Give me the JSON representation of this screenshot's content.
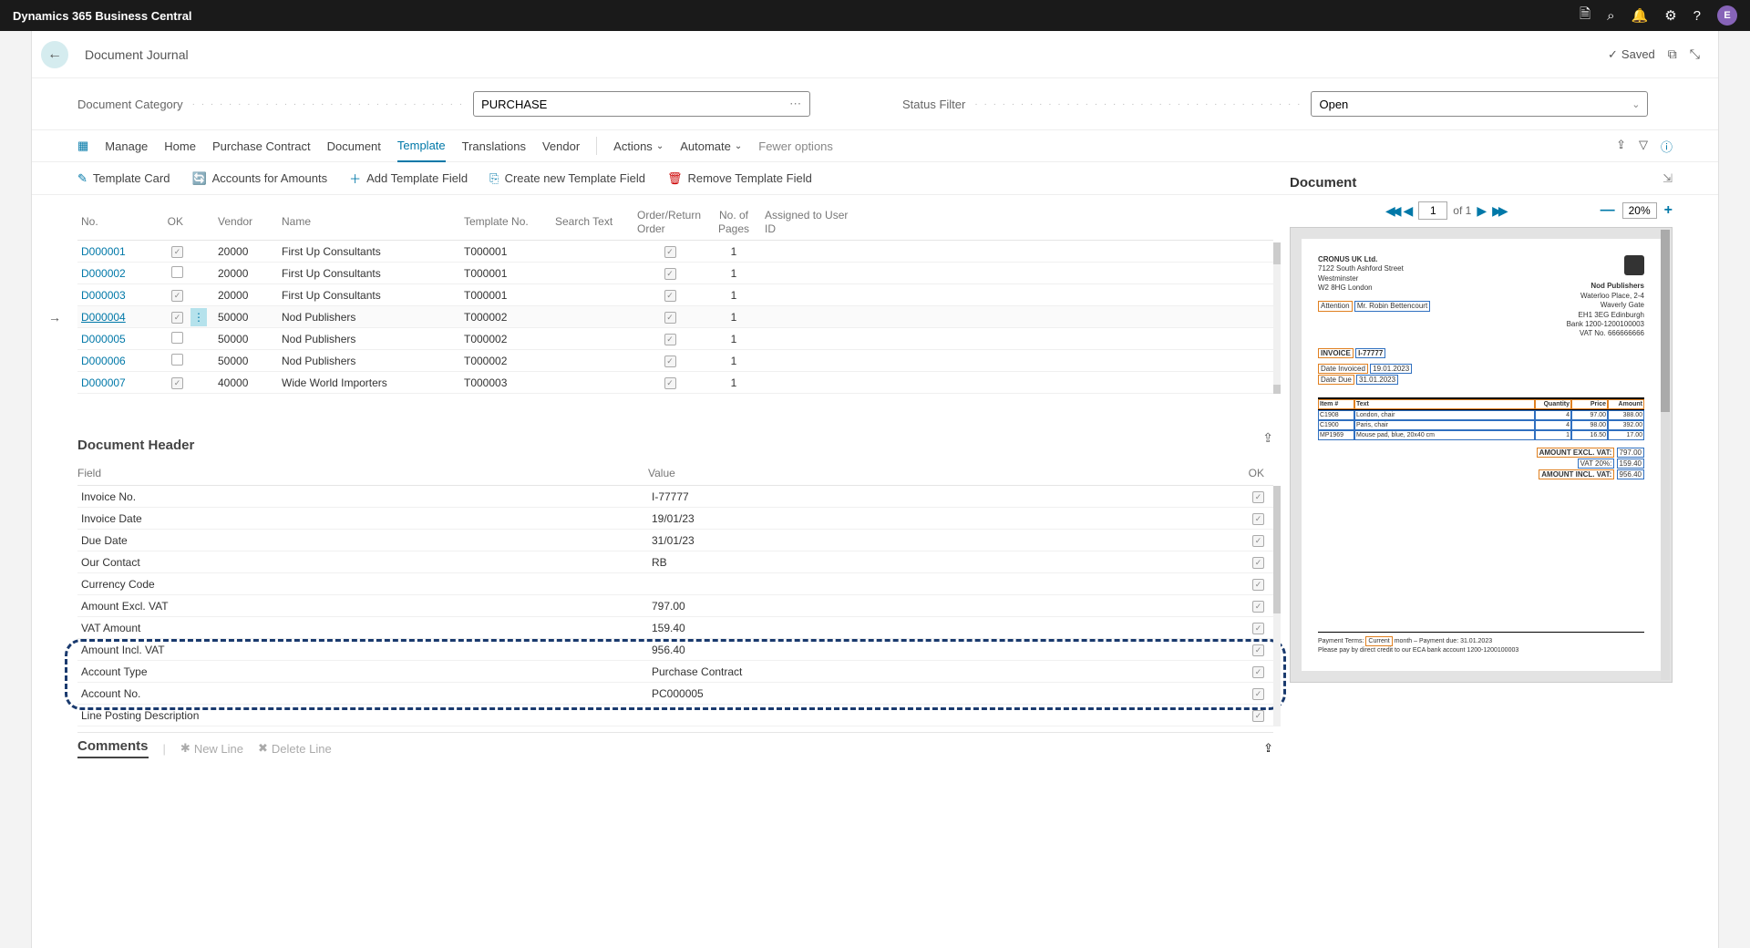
{
  "topbar": {
    "title": "Dynamics 365 Business Central",
    "avatar": "E"
  },
  "page": {
    "title": "Document Journal",
    "saved": "Saved"
  },
  "filters": {
    "category_label": "Document Category",
    "category_value": "PURCHASE",
    "status_label": "Status Filter",
    "status_value": "Open"
  },
  "menu": {
    "items": [
      "Manage",
      "Home",
      "Purchase Contract",
      "Document",
      "Template",
      "Translations",
      "Vendor"
    ],
    "actions": "Actions",
    "automate": "Automate",
    "fewer": "Fewer options"
  },
  "submenu": {
    "template_card": "Template Card",
    "accounts": "Accounts for Amounts",
    "add_field": "Add Template Field",
    "create_field": "Create new Template Field",
    "remove_field": "Remove Template Field"
  },
  "grid": {
    "headers": {
      "no": "No.",
      "ok": "OK",
      "vendor": "Vendor",
      "name": "Name",
      "template": "Template No.",
      "search": "Search Text",
      "order": "Order/Return Order",
      "pages": "No. of Pages",
      "assigned": "Assigned to User ID"
    },
    "rows": [
      {
        "no": "D000001",
        "ok": true,
        "menu": false,
        "vendor": "20000",
        "name": "First Up Consultants",
        "template": "T000001",
        "order": true,
        "pages": "1"
      },
      {
        "no": "D000002",
        "ok": false,
        "menu": false,
        "vendor": "20000",
        "name": "First Up Consultants",
        "template": "T000001",
        "order": true,
        "pages": "1"
      },
      {
        "no": "D000003",
        "ok": true,
        "menu": false,
        "vendor": "20000",
        "name": "First Up Consultants",
        "template": "T000001",
        "order": true,
        "pages": "1"
      },
      {
        "no": "D000004",
        "ok": true,
        "menu": true,
        "selected": true,
        "vendor": "50000",
        "name": "Nod Publishers",
        "template": "T000002",
        "order": true,
        "pages": "1"
      },
      {
        "no": "D000005",
        "ok": false,
        "menu": false,
        "vendor": "50000",
        "name": "Nod Publishers",
        "template": "T000002",
        "order": true,
        "pages": "1"
      },
      {
        "no": "D000006",
        "ok": false,
        "menu": false,
        "vendor": "50000",
        "name": "Nod Publishers",
        "template": "T000002",
        "order": true,
        "pages": "1"
      },
      {
        "no": "D000007",
        "ok": true,
        "menu": false,
        "vendor": "40000",
        "name": "Wide World Importers",
        "template": "T000003",
        "order": true,
        "pages": "1"
      }
    ]
  },
  "docheader": {
    "title": "Document Header",
    "cols": {
      "field": "Field",
      "value": "Value",
      "ok": "OK"
    },
    "rows": [
      {
        "field": "Invoice No.",
        "value": "I-77777",
        "ok": true
      },
      {
        "field": "Invoice Date",
        "value": "19/01/23",
        "ok": true
      },
      {
        "field": "Due Date",
        "value": "31/01/23",
        "ok": true
      },
      {
        "field": "Our Contact",
        "value": "RB",
        "ok": true
      },
      {
        "field": "Currency Code",
        "value": "",
        "ok": true
      },
      {
        "field": "Amount Excl. VAT",
        "value": "797.00",
        "ok": true
      },
      {
        "field": "VAT Amount",
        "value": "159.40",
        "ok": true
      },
      {
        "field": "Amount Incl. VAT",
        "value": "956.40",
        "ok": true
      },
      {
        "field": "Account Type",
        "value": "Purchase Contract",
        "ok": true
      },
      {
        "field": "Account No.",
        "value": "PC000005",
        "ok": true
      },
      {
        "field": "Line Posting Description",
        "value": "",
        "ok": true
      }
    ]
  },
  "comments": {
    "title": "Comments",
    "new": "New Line",
    "delete": "Delete Line"
  },
  "preview": {
    "title": "Document",
    "page": "1",
    "of": "of 1",
    "zoom": "20%",
    "from": {
      "l1": "CRONUS UK Ltd.",
      "l2": "7122 South Ashford Street",
      "l3": "Westminster",
      "l4": "W2 8HG London"
    },
    "attn_label": "Attention",
    "attn_val": "Mr. Robin Bettencourt",
    "to": {
      "l1": "Nod Publishers",
      "l2": "Waterloo Place, 2-4",
      "l3": "Waverly Gate",
      "l4": "EH1 3EG Edinburgh",
      "l5": "Bank 1200-1200100003",
      "l6": "VAT No. 666666666"
    },
    "inv_label": "INVOICE",
    "inv_no": "I-77777",
    "date_inv_label": "Date Invoiced",
    "date_inv": "19.01.2023",
    "date_due_label": "Date Due",
    "date_due": "31.01.2023",
    "thead": {
      "item": "Item #",
      "text": "Text",
      "qty": "Quantity",
      "price": "Price",
      "amount": "Amount"
    },
    "lines": [
      {
        "item": "C1908",
        "text": "London, chair",
        "qty": "4",
        "price": "97.00",
        "amount": "388.00"
      },
      {
        "item": "C1900",
        "text": "Paris, chair",
        "qty": "4",
        "price": "98.00",
        "amount": "392.00"
      },
      {
        "item": "MP1969",
        "text": "Mouse pad, blue, 20x40 cm",
        "qty": "1",
        "price": "16.50",
        "amount": "17.00"
      }
    ],
    "tot_excl_label": "AMOUNT EXCL. VAT:",
    "tot_excl": "797.00",
    "vat_label": "VAT 20%:",
    "vat": "159.40",
    "tot_incl_label": "AMOUNT INCL. VAT:",
    "tot_incl": "956.40",
    "foot1a": "Payment Terms:",
    "foot1_hl": "Current",
    "foot1b": "month – Payment due: 31.01.2023",
    "foot2": "Please pay by direct credit to our ECA bank account 1200-1200100003"
  }
}
